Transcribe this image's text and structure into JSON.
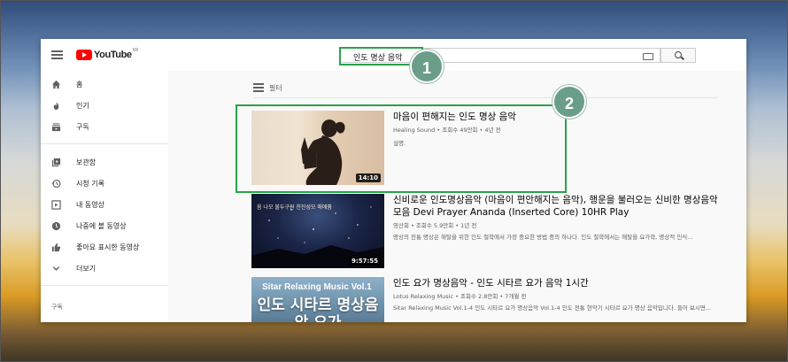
{
  "header": {
    "logo_text": "YouTube",
    "logo_region": "KR",
    "search_value": "인도 명상 음악"
  },
  "badges": [
    "1",
    "2"
  ],
  "sidebar": {
    "items": [
      {
        "label": "홈",
        "icon": "home-icon"
      },
      {
        "label": "인기",
        "icon": "fire-icon"
      },
      {
        "label": "구독",
        "icon": "subscriptions-icon"
      },
      {
        "label": "보관함",
        "icon": "library-icon"
      },
      {
        "label": "시청 기록",
        "icon": "history-icon"
      },
      {
        "label": "내 동영상",
        "icon": "my-videos-icon"
      },
      {
        "label": "나중에 볼 동영상",
        "icon": "clock-icon"
      },
      {
        "label": "좋아요 표시한 동영상",
        "icon": "thumbs-up-icon"
      },
      {
        "label": "더보기",
        "icon": "chevron-down-icon"
      }
    ],
    "section_label": "구독"
  },
  "filter": {
    "label": "필터"
  },
  "results": [
    {
      "title": "마음이 편해지는 인도 명상 음악",
      "meta": "Healing Sound • 조회수 49만회 • 4년 전",
      "desc": "설명.",
      "duration": "14:10"
    },
    {
      "title": "신비로운 인도명상음악 (마음이 편안해지는 음악), 행운을 불러오는 신비한 명상음악모음 Devi Prayer Ananda (Inserted Core) 10HR Play",
      "meta": "영산회 • 조회수 5.9만회 • 1년 전",
      "desc": "명상의 전통 명상은 해탈을 위한 인도 철학에서 가장 중요한 방법 중의 하나다. 인도 철학에서는 해탈을 요가학, 명상적 인식...",
      "duration": "9:57:55",
      "thumb_text": "옴 나모 불두구원 천진성모 매애흉"
    },
    {
      "title": "인도 요가 명상음악 - 인도 시타르 요가 음악 1시간",
      "meta": "Lotus Relaxing Music • 조회수 2.8만회 • 7개월 전",
      "desc": "Sitar Relaxing Music Vol.1-4 인도 시타르 요가 명상음악 Vol.1-4 인도 전통 현악기 시타르 요가 명상 음악입니다. 들어 보시면...",
      "thumb_title": "Sitar Relaxing Music Vol.1",
      "thumb_kr": "인도 시타르 명상음악 요가"
    }
  ],
  "colors": {
    "highlight": "#2aa14a",
    "badge": "#6a9e88",
    "youtube_red": "#ff0000"
  }
}
